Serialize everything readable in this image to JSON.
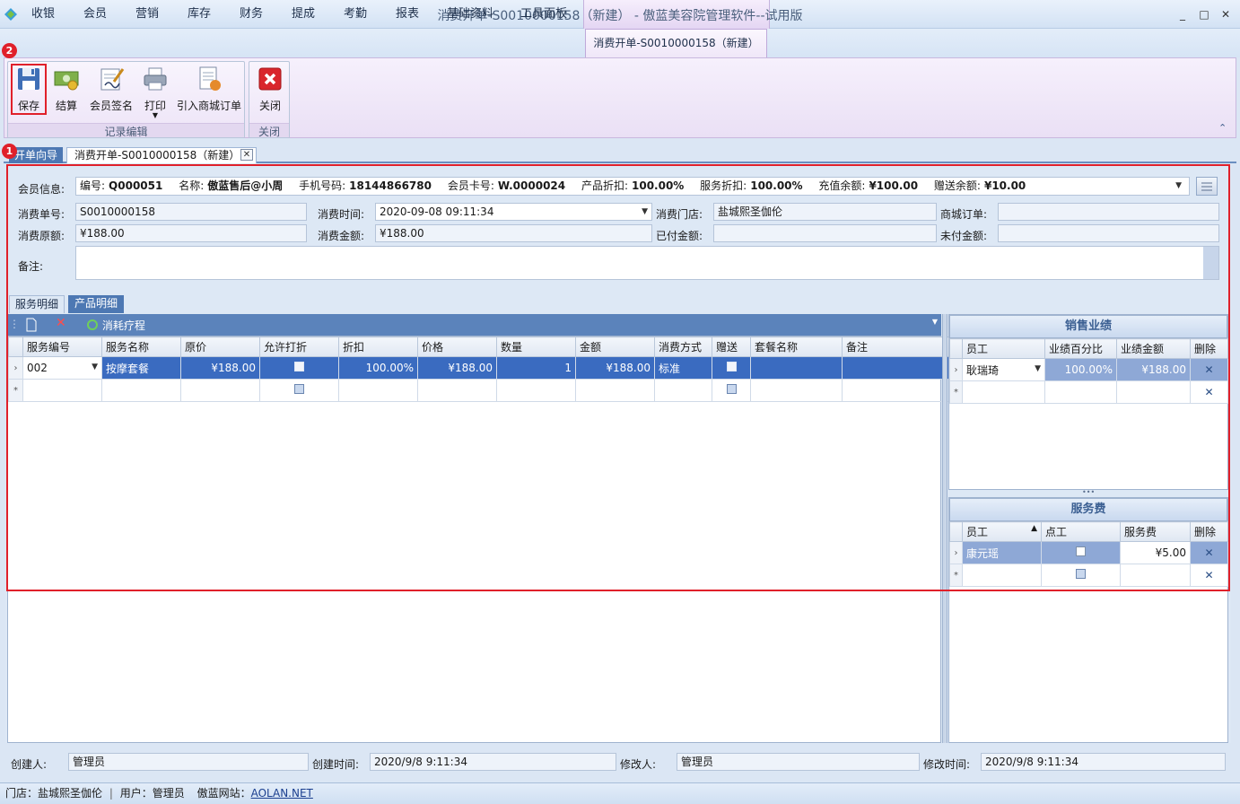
{
  "window": {
    "title": "消费开单-S0010000158（新建） - 傲蓝美容院管理软件--试用版",
    "minimize": "_",
    "maximize": "□",
    "close": "✕"
  },
  "menu": {
    "tabs": [
      "收银",
      "会员",
      "营销",
      "库存",
      "财务",
      "提成",
      "考勤",
      "报表",
      "基础资料",
      "工具面板"
    ],
    "active_tab": "消费开单-S0010000158（新建）"
  },
  "ribbon": {
    "group1_label": "记录编辑",
    "group2_label": "关闭",
    "buttons": {
      "save": "保存",
      "settle": "结算",
      "member_sign": "会员签名",
      "print": "打印",
      "import_order": "引入商城订单",
      "close": "关闭"
    },
    "badge_save": "2",
    "badge_frame": "1"
  },
  "doc_tabs": {
    "wizard": "开单向导",
    "order": "消费开单-S0010000158（新建）"
  },
  "form": {
    "member_info_label": "会员信息:",
    "member": {
      "id_label": "编号:",
      "id": "Q000051",
      "name_label": "名称:",
      "name": "傲蓝售后@小周",
      "phone_label": "手机号码:",
      "phone": "18144866780",
      "card_label": "会员卡号:",
      "card": "W.0000024",
      "product_discount_label": "产品折扣:",
      "product_discount": "100.00%",
      "service_discount_label": "服务折扣:",
      "service_discount": "100.00%",
      "balance_label": "充值余额:",
      "balance": "¥100.00",
      "gift_label": "赠送余额:",
      "gift": "¥10.00"
    },
    "order_no_label": "消费单号:",
    "order_no": "S0010000158",
    "time_label": "消费时间:",
    "time": "2020-09-08 09:11:34",
    "store_label": "消费门店:",
    "store": "盐城熙圣伽伦",
    "mall_order_label": "商城订单:",
    "mall_order": "",
    "original_label": "消费原额:",
    "original": "¥188.00",
    "amount_label": "消费金额:",
    "amount": "¥188.00",
    "paid_label": "已付金额:",
    "paid": "",
    "unpaid_label": "未付金额:",
    "unpaid": "",
    "remark_label": "备注:",
    "remark": ""
  },
  "sub_tabs": {
    "service": "服务明细",
    "product": "产品明细"
  },
  "grid_toolbar": {
    "consume": "消耗疗程"
  },
  "grid": {
    "columns": [
      "服务编号",
      "服务名称",
      "原价",
      "允许打折",
      "折扣",
      "价格",
      "数量",
      "金额",
      "消费方式",
      "赠送",
      "套餐名称",
      "备注"
    ],
    "rows": [
      {
        "code": "002",
        "name": "按摩套餐",
        "orig_price": "¥188.00",
        "discount": "100.00%",
        "price": "¥188.00",
        "qty": "1",
        "amount": "¥188.00",
        "method": "标准",
        "package": "",
        "remark": ""
      }
    ]
  },
  "sales_panel": {
    "title": "销售业绩",
    "columns": [
      "员工",
      "业绩百分比",
      "业绩金额",
      "删除"
    ],
    "rows": [
      {
        "staff": "耿瑞琦",
        "percent": "100.00%",
        "amount": "¥188.00"
      }
    ]
  },
  "fee_panel": {
    "title": "服务费",
    "columns": [
      "员工",
      "点工",
      "服务费",
      "删除"
    ],
    "rows": [
      {
        "staff": "康元瑶",
        "fee": "¥5.00"
      }
    ]
  },
  "audit": {
    "creator_label": "创建人:",
    "creator": "管理员",
    "created_label": "创建时间:",
    "created": "2020/9/8 9:11:34",
    "modifier_label": "修改人:",
    "modifier": "管理员",
    "modified_label": "修改时间:",
    "modified": "2020/9/8 9:11:34"
  },
  "status": {
    "store": "门店：盐城熙圣伽伦",
    "user": "用户：管理员",
    "website_label": "傲蓝网站：",
    "website": "AOLAN.NET"
  }
}
